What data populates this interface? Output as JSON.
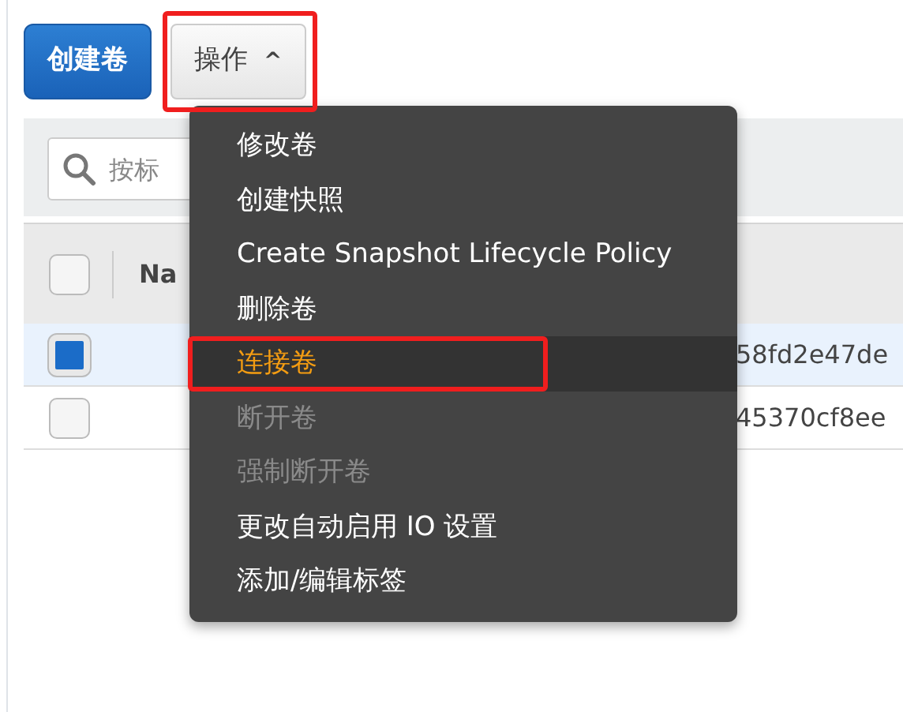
{
  "toolbar": {
    "create_button": "创建卷",
    "actions_button": {
      "label": "操作",
      "caret": "^",
      "expanded": true,
      "annotation_frame": true
    }
  },
  "search": {
    "placeholder": "按标"
  },
  "table": {
    "select_all": false,
    "columns": [
      "Na"
    ],
    "rows": [
      {
        "selected": true,
        "column_2": "58fd2e47de"
      },
      {
        "selected": false,
        "column_2": "45370cf8ee"
      }
    ]
  },
  "actions_menu": [
    {
      "label": "修改卷",
      "disabled": false,
      "hovered": false,
      "annotation_frame": false
    },
    {
      "label": "创建快照",
      "disabled": false,
      "hovered": false,
      "annotation_frame": false
    },
    {
      "label": "Create Snapshot Lifecycle Policy",
      "disabled": false,
      "hovered": false,
      "annotation_frame": false
    },
    {
      "label": "删除卷",
      "disabled": false,
      "hovered": false,
      "annotation_frame": false
    },
    {
      "label": "连接卷",
      "disabled": false,
      "hovered": true,
      "annotation_frame": true
    },
    {
      "label": "断开卷",
      "disabled": true,
      "hovered": false,
      "annotation_frame": false
    },
    {
      "label": "强制断开卷",
      "disabled": true,
      "hovered": false,
      "annotation_frame": false
    },
    {
      "label": "更改自动启用 IO 设置",
      "disabled": false,
      "hovered": false,
      "annotation_frame": false
    },
    {
      "label": "添加/编辑标签",
      "disabled": false,
      "hovered": false,
      "annotation_frame": false
    }
  ]
}
